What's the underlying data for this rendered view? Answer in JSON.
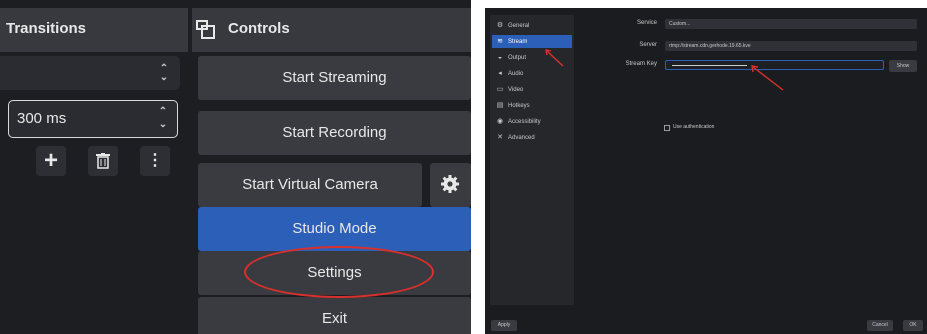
{
  "left_panel": {
    "transitions_title": "Transitions",
    "controls_title": "Controls",
    "duration_value": "300 ms",
    "buttons": {
      "start_streaming": "Start Streaming",
      "start_recording": "Start Recording",
      "start_virtual_camera": "Start Virtual Camera",
      "studio_mode": "Studio Mode",
      "settings": "Settings",
      "exit": "Exit"
    },
    "annotation_color": "#d9302c",
    "active_color": "#2c5fb8"
  },
  "settings_window": {
    "sidebar": [
      {
        "label": "General",
        "icon": "gear-icon",
        "glyph": "⚙"
      },
      {
        "label": "Stream",
        "icon": "antenna-icon",
        "glyph": "≋"
      },
      {
        "label": "Output",
        "icon": "output-icon",
        "glyph": "◒"
      },
      {
        "label": "Audio",
        "icon": "speaker-icon",
        "glyph": "◂"
      },
      {
        "label": "Video",
        "icon": "monitor-icon",
        "glyph": "▭"
      },
      {
        "label": "Hotkeys",
        "icon": "keyboard-icon",
        "glyph": "▤"
      },
      {
        "label": "Accessibility",
        "icon": "accessibility-icon",
        "glyph": "◉"
      },
      {
        "label": "Advanced",
        "icon": "wrench-icon",
        "glyph": "✕"
      }
    ],
    "active_section": "Stream",
    "service_label": "Service",
    "service_value": "Custom...",
    "server_label": "Server",
    "server_value": "rtmp://stream.cdn.gerhode.19.65.kve",
    "stream_key_label": "Stream Key",
    "show_label": "Show",
    "auth_label": "Use authentication",
    "apply_label": "Apply",
    "cancel_label": "Cancel",
    "ok_label": "OK"
  }
}
